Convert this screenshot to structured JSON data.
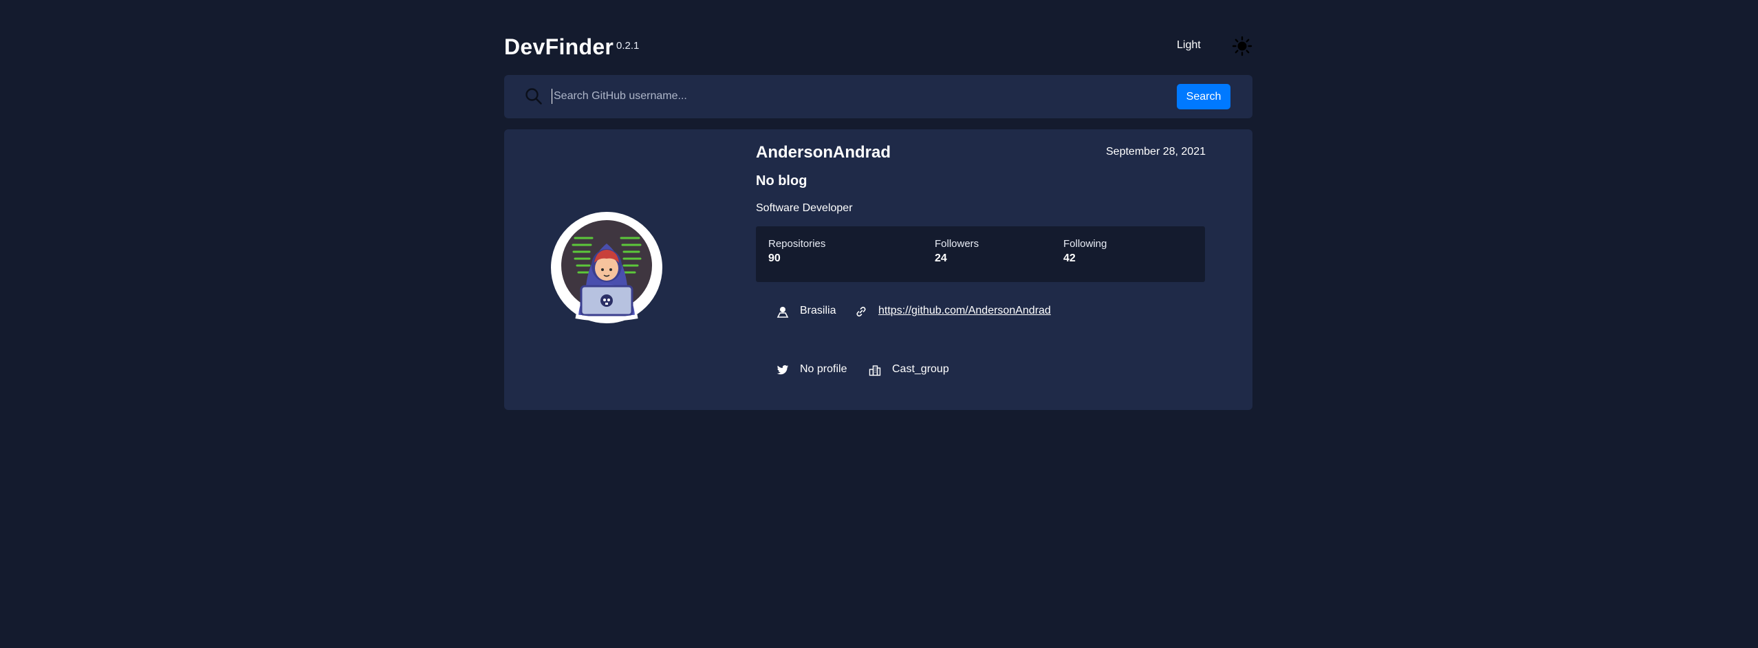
{
  "header": {
    "title": "DevFinder",
    "version": "0.2.1",
    "theme_label": "Light"
  },
  "search": {
    "placeholder": "Search GitHub username...",
    "value": "",
    "button_label": "Search"
  },
  "profile": {
    "username": "AndersonAndrad",
    "joined": "September 28, 2021",
    "blog": "No blog",
    "bio": "Software Developer",
    "stats": [
      {
        "label": "Repositories",
        "value": "90"
      },
      {
        "label": "Followers",
        "value": "24"
      },
      {
        "label": "Following",
        "value": "42"
      }
    ],
    "location": "Brasilia",
    "website": "https://github.com/AndersonAndrad",
    "twitter": "No profile",
    "company": "Cast_group"
  },
  "icons": {
    "theme": "sun-icon",
    "search": "search-icon",
    "location": "location-pin-icon",
    "website": "link-icon",
    "twitter": "twitter-icon",
    "company": "building-icon"
  },
  "colors": {
    "background": "#141b2e",
    "card": "#1f2a48",
    "accent": "#0079ff",
    "text": "#ffffff"
  }
}
